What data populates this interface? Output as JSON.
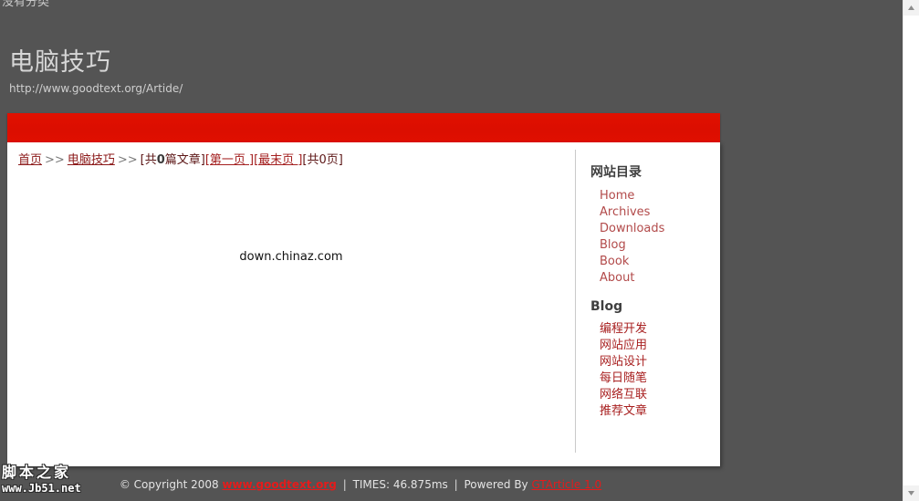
{
  "topstrip": {
    "text": "没有分类"
  },
  "header": {
    "title": "电脑技巧",
    "url": "http://www.goodtext.org/Artide/"
  },
  "banner": {
    "color": "#db0e00"
  },
  "breadcrumb": {
    "home_label": "首页",
    "sep1": ">>",
    "category_label": "电脑技巧",
    "sep2": ">>",
    "total_prefix": "[共",
    "total_count": "0",
    "total_suffix": "篇文章]",
    "first_page_label": "[第一页 ]",
    "last_page_label": "[最末页 ]",
    "page_total": "[共0页]"
  },
  "content": {
    "center_note": "down.chinaz.com"
  },
  "sidebar": {
    "directory_heading": "网站目录",
    "directory_items": [
      {
        "label": "Home"
      },
      {
        "label": "Archives"
      },
      {
        "label": "Downloads"
      },
      {
        "label": "Blog"
      },
      {
        "label": "Book"
      },
      {
        "label": "About"
      }
    ],
    "blog_heading": "Blog",
    "blog_items": [
      {
        "label": "编程开发"
      },
      {
        "label": "网站应用"
      },
      {
        "label": "网站设计"
      },
      {
        "label": "每日随笔"
      },
      {
        "label": "网络互联"
      },
      {
        "label": "推荐文章"
      }
    ]
  },
  "footer": {
    "copyright": "© Copyright 2008",
    "site_link": "www.goodtext.org",
    "bar1": "|",
    "times": "TIMES: 46.875ms",
    "bar2": "|",
    "powered_by": "Powered By",
    "engine_link": "GTArticle 1.0"
  },
  "watermark": {
    "cn": "脚本之家",
    "url": "www.Jb51.net"
  },
  "scrollbar": {
    "up_icon": "scroll-up-icon",
    "down_icon": "scroll-down-icon"
  },
  "colors": {
    "page_background": "#545454",
    "banner_red": "#db0e00",
    "link_red": "#a82020",
    "content_background": "#ffffff"
  }
}
